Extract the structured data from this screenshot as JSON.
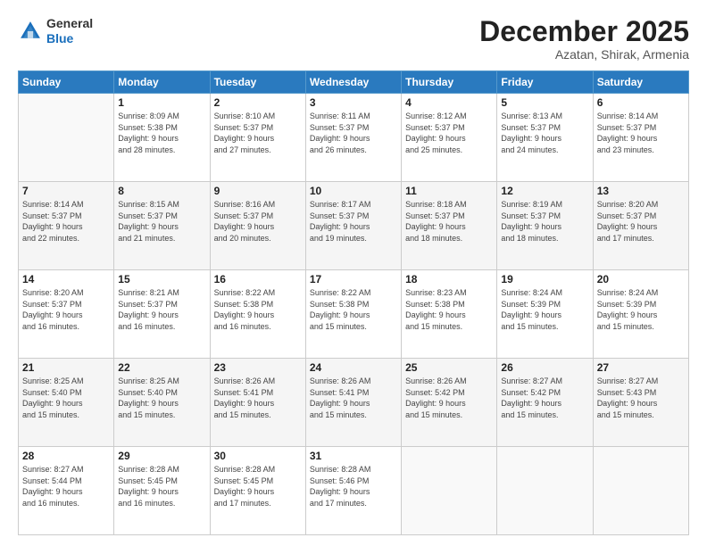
{
  "logo": {
    "general": "General",
    "blue": "Blue"
  },
  "header": {
    "month": "December 2025",
    "location": "Azatan, Shirak, Armenia"
  },
  "weekdays": [
    "Sunday",
    "Monday",
    "Tuesday",
    "Wednesday",
    "Thursday",
    "Friday",
    "Saturday"
  ],
  "weeks": [
    [
      {
        "day": "",
        "sunrise": "",
        "sunset": "",
        "daylight": ""
      },
      {
        "day": "1",
        "sunrise": "Sunrise: 8:09 AM",
        "sunset": "Sunset: 5:38 PM",
        "daylight": "Daylight: 9 hours and 28 minutes."
      },
      {
        "day": "2",
        "sunrise": "Sunrise: 8:10 AM",
        "sunset": "Sunset: 5:37 PM",
        "daylight": "Daylight: 9 hours and 27 minutes."
      },
      {
        "day": "3",
        "sunrise": "Sunrise: 8:11 AM",
        "sunset": "Sunset: 5:37 PM",
        "daylight": "Daylight: 9 hours and 26 minutes."
      },
      {
        "day": "4",
        "sunrise": "Sunrise: 8:12 AM",
        "sunset": "Sunset: 5:37 PM",
        "daylight": "Daylight: 9 hours and 25 minutes."
      },
      {
        "day": "5",
        "sunrise": "Sunrise: 8:13 AM",
        "sunset": "Sunset: 5:37 PM",
        "daylight": "Daylight: 9 hours and 24 minutes."
      },
      {
        "day": "6",
        "sunrise": "Sunrise: 8:14 AM",
        "sunset": "Sunset: 5:37 PM",
        "daylight": "Daylight: 9 hours and 23 minutes."
      }
    ],
    [
      {
        "day": "7",
        "sunrise": "Sunrise: 8:14 AM",
        "sunset": "Sunset: 5:37 PM",
        "daylight": "Daylight: 9 hours and 22 minutes."
      },
      {
        "day": "8",
        "sunrise": "Sunrise: 8:15 AM",
        "sunset": "Sunset: 5:37 PM",
        "daylight": "Daylight: 9 hours and 21 minutes."
      },
      {
        "day": "9",
        "sunrise": "Sunrise: 8:16 AM",
        "sunset": "Sunset: 5:37 PM",
        "daylight": "Daylight: 9 hours and 20 minutes."
      },
      {
        "day": "10",
        "sunrise": "Sunrise: 8:17 AM",
        "sunset": "Sunset: 5:37 PM",
        "daylight": "Daylight: 9 hours and 19 minutes."
      },
      {
        "day": "11",
        "sunrise": "Sunrise: 8:18 AM",
        "sunset": "Sunset: 5:37 PM",
        "daylight": "Daylight: 9 hours and 18 minutes."
      },
      {
        "day": "12",
        "sunrise": "Sunrise: 8:19 AM",
        "sunset": "Sunset: 5:37 PM",
        "daylight": "Daylight: 9 hours and 18 minutes."
      },
      {
        "day": "13",
        "sunrise": "Sunrise: 8:20 AM",
        "sunset": "Sunset: 5:37 PM",
        "daylight": "Daylight: 9 hours and 17 minutes."
      }
    ],
    [
      {
        "day": "14",
        "sunrise": "Sunrise: 8:20 AM",
        "sunset": "Sunset: 5:37 PM",
        "daylight": "Daylight: 9 hours and 16 minutes."
      },
      {
        "day": "15",
        "sunrise": "Sunrise: 8:21 AM",
        "sunset": "Sunset: 5:37 PM",
        "daylight": "Daylight: 9 hours and 16 minutes."
      },
      {
        "day": "16",
        "sunrise": "Sunrise: 8:22 AM",
        "sunset": "Sunset: 5:38 PM",
        "daylight": "Daylight: 9 hours and 16 minutes."
      },
      {
        "day": "17",
        "sunrise": "Sunrise: 8:22 AM",
        "sunset": "Sunset: 5:38 PM",
        "daylight": "Daylight: 9 hours and 15 minutes."
      },
      {
        "day": "18",
        "sunrise": "Sunrise: 8:23 AM",
        "sunset": "Sunset: 5:38 PM",
        "daylight": "Daylight: 9 hours and 15 minutes."
      },
      {
        "day": "19",
        "sunrise": "Sunrise: 8:24 AM",
        "sunset": "Sunset: 5:39 PM",
        "daylight": "Daylight: 9 hours and 15 minutes."
      },
      {
        "day": "20",
        "sunrise": "Sunrise: 8:24 AM",
        "sunset": "Sunset: 5:39 PM",
        "daylight": "Daylight: 9 hours and 15 minutes."
      }
    ],
    [
      {
        "day": "21",
        "sunrise": "Sunrise: 8:25 AM",
        "sunset": "Sunset: 5:40 PM",
        "daylight": "Daylight: 9 hours and 15 minutes."
      },
      {
        "day": "22",
        "sunrise": "Sunrise: 8:25 AM",
        "sunset": "Sunset: 5:40 PM",
        "daylight": "Daylight: 9 hours and 15 minutes."
      },
      {
        "day": "23",
        "sunrise": "Sunrise: 8:26 AM",
        "sunset": "Sunset: 5:41 PM",
        "daylight": "Daylight: 9 hours and 15 minutes."
      },
      {
        "day": "24",
        "sunrise": "Sunrise: 8:26 AM",
        "sunset": "Sunset: 5:41 PM",
        "daylight": "Daylight: 9 hours and 15 minutes."
      },
      {
        "day": "25",
        "sunrise": "Sunrise: 8:26 AM",
        "sunset": "Sunset: 5:42 PM",
        "daylight": "Daylight: 9 hours and 15 minutes."
      },
      {
        "day": "26",
        "sunrise": "Sunrise: 8:27 AM",
        "sunset": "Sunset: 5:42 PM",
        "daylight": "Daylight: 9 hours and 15 minutes."
      },
      {
        "day": "27",
        "sunrise": "Sunrise: 8:27 AM",
        "sunset": "Sunset: 5:43 PM",
        "daylight": "Daylight: 9 hours and 15 minutes."
      }
    ],
    [
      {
        "day": "28",
        "sunrise": "Sunrise: 8:27 AM",
        "sunset": "Sunset: 5:44 PM",
        "daylight": "Daylight: 9 hours and 16 minutes."
      },
      {
        "day": "29",
        "sunrise": "Sunrise: 8:28 AM",
        "sunset": "Sunset: 5:45 PM",
        "daylight": "Daylight: 9 hours and 16 minutes."
      },
      {
        "day": "30",
        "sunrise": "Sunrise: 8:28 AM",
        "sunset": "Sunset: 5:45 PM",
        "daylight": "Daylight: 9 hours and 17 minutes."
      },
      {
        "day": "31",
        "sunrise": "Sunrise: 8:28 AM",
        "sunset": "Sunset: 5:46 PM",
        "daylight": "Daylight: 9 hours and 17 minutes."
      },
      {
        "day": "",
        "sunrise": "",
        "sunset": "",
        "daylight": ""
      },
      {
        "day": "",
        "sunrise": "",
        "sunset": "",
        "daylight": ""
      },
      {
        "day": "",
        "sunrise": "",
        "sunset": "",
        "daylight": ""
      }
    ]
  ]
}
